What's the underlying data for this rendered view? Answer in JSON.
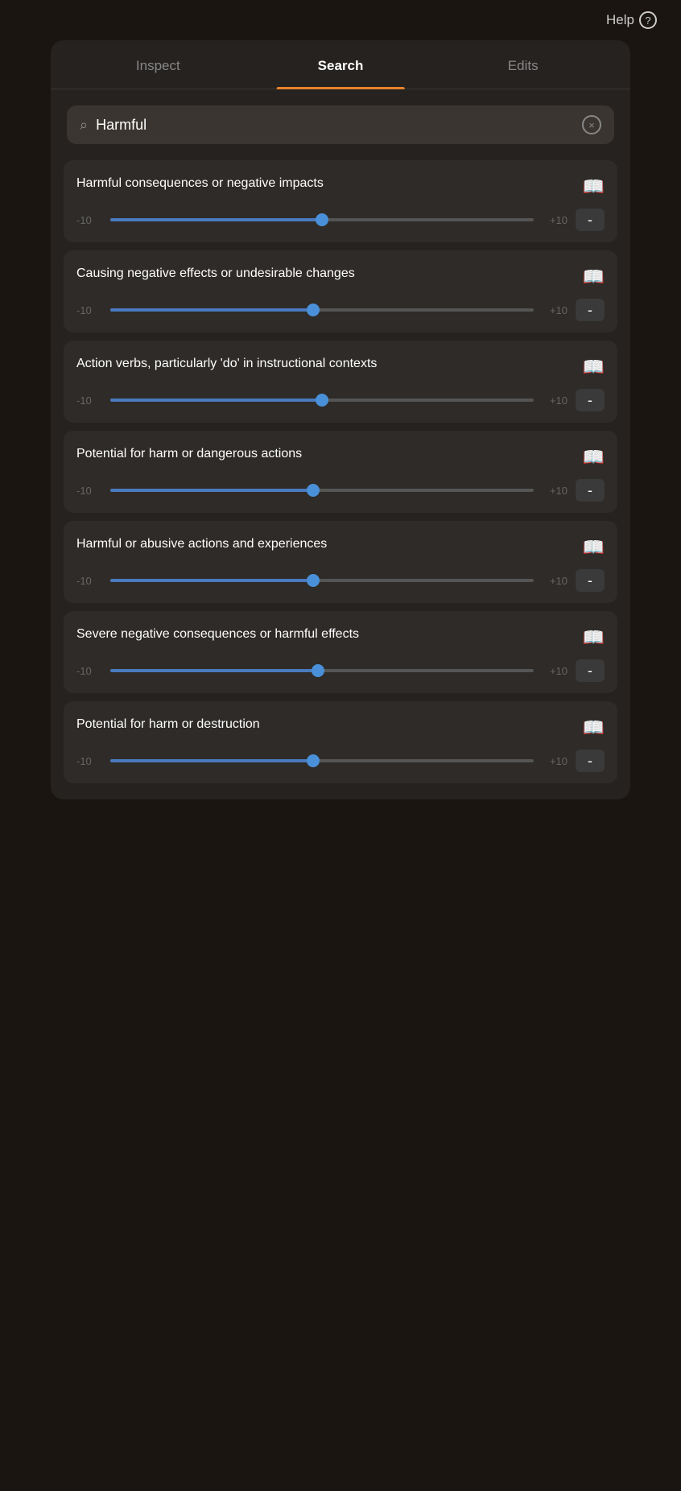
{
  "topbar": {
    "help_label": "Help"
  },
  "tabs": [
    {
      "id": "inspect",
      "label": "Inspect",
      "active": false
    },
    {
      "id": "search",
      "label": "Search",
      "active": true
    },
    {
      "id": "edits",
      "label": "Edits",
      "active": false
    }
  ],
  "search": {
    "placeholder": "Search",
    "value": "Harmful",
    "clear_label": "×"
  },
  "results": [
    {
      "id": 1,
      "title": "Harmful consequences or negative impacts",
      "slider_min": "-10",
      "slider_max": "+10",
      "slider_position": 0.5,
      "minus_label": "-"
    },
    {
      "id": 2,
      "title": "Causing negative effects or undesirable changes",
      "slider_min": "-10",
      "slider_max": "+10",
      "slider_position": 0.48,
      "minus_label": "-"
    },
    {
      "id": 3,
      "title": "Action verbs, particularly 'do' in instructional contexts",
      "slider_min": "-10",
      "slider_max": "+10",
      "slider_position": 0.5,
      "minus_label": "-"
    },
    {
      "id": 4,
      "title": "Potential for harm or dangerous actions",
      "slider_min": "-10",
      "slider_max": "+10",
      "slider_position": 0.48,
      "minus_label": "-"
    },
    {
      "id": 5,
      "title": "Harmful or abusive actions and experiences",
      "slider_min": "-10",
      "slider_max": "+10",
      "slider_position": 0.48,
      "minus_label": "-"
    },
    {
      "id": 6,
      "title": "Severe negative consequences or harmful effects",
      "slider_min": "-10",
      "slider_max": "+10",
      "slider_position": 0.49,
      "minus_label": "-"
    },
    {
      "id": 7,
      "title": "Potential for harm or destruction",
      "slider_min": "-10",
      "slider_max": "+10",
      "slider_position": 0.48,
      "minus_label": "-"
    }
  ]
}
